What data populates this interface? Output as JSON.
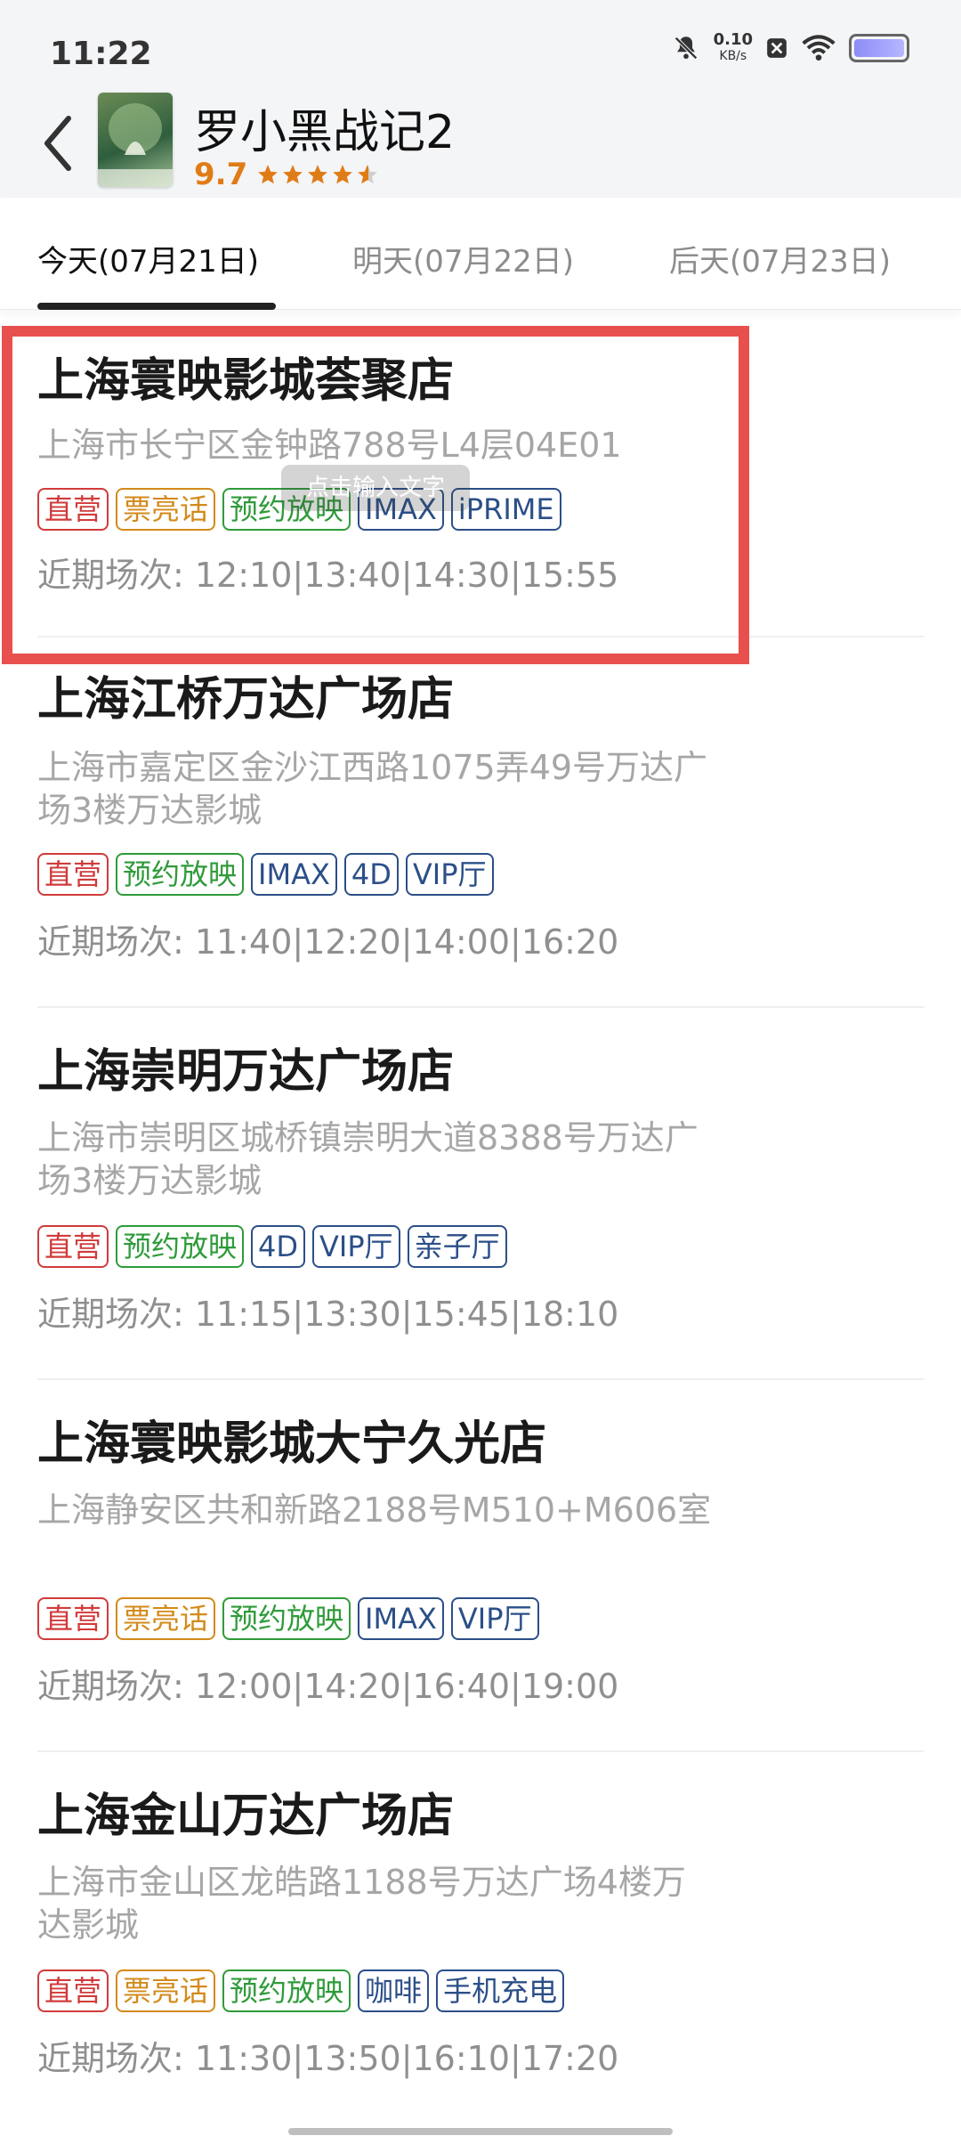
{
  "status": {
    "time": "11:22",
    "net_speed_value": "0.10",
    "net_speed_unit": "KB/s"
  },
  "header": {
    "title": "罗小黑战记2",
    "rating": "9.7"
  },
  "tabs": [
    {
      "label": "今天(07月21日)",
      "active": true
    },
    {
      "label": "明天(07月22日)",
      "active": false
    },
    {
      "label": "后天(07月23日)",
      "active": false
    }
  ],
  "cinemas": [
    {
      "name": "上海寰映影城荟聚店",
      "address": "上海市长宁区金钟路788号L4层04E01",
      "tags": [
        {
          "label": "直营",
          "color": "red"
        },
        {
          "label": "票亮话",
          "color": "orange"
        },
        {
          "label": "预约放映",
          "color": "green"
        },
        {
          "label": "IMAX",
          "color": "blue"
        },
        {
          "label": "iPRIME",
          "color": "blue"
        }
      ],
      "showtimes": "近期场次: 12:10|13:40|14:30|15:55"
    },
    {
      "name": "上海江桥万达广场店",
      "address": "上海市嘉定区金沙江西路1075弄49号万达广场3楼万达影城",
      "tags": [
        {
          "label": "直营",
          "color": "red"
        },
        {
          "label": "预约放映",
          "color": "green"
        },
        {
          "label": "IMAX",
          "color": "blue"
        },
        {
          "label": "4D",
          "color": "blue"
        },
        {
          "label": "VIP厅",
          "color": "blue"
        }
      ],
      "showtimes": "近期场次: 11:40|12:20|14:00|16:20"
    },
    {
      "name": "上海崇明万达广场店",
      "address": "上海市崇明区城桥镇崇明大道8388号万达广场3楼万达影城",
      "tags": [
        {
          "label": "直营",
          "color": "red"
        },
        {
          "label": "预约放映",
          "color": "green"
        },
        {
          "label": "4D",
          "color": "blue"
        },
        {
          "label": "VIP厅",
          "color": "blue"
        },
        {
          "label": "亲子厅",
          "color": "blue"
        }
      ],
      "showtimes": "近期场次: 11:15|13:30|15:45|18:10"
    },
    {
      "name": "上海寰映影城大宁久光店",
      "address": "上海静安区共和新路2188号M510+M606室",
      "tags": [
        {
          "label": "直营",
          "color": "red"
        },
        {
          "label": "票亮话",
          "color": "orange"
        },
        {
          "label": "预约放映",
          "color": "green"
        },
        {
          "label": "IMAX",
          "color": "blue"
        },
        {
          "label": "VIP厅",
          "color": "blue"
        }
      ],
      "showtimes": "近期场次: 12:00|14:20|16:40|19:00"
    },
    {
      "name": "上海金山万达广场店",
      "address": "上海市金山区龙皓路1188号万达广场4楼万达影城",
      "tags": [
        {
          "label": "直营",
          "color": "red"
        },
        {
          "label": "票亮话",
          "color": "orange"
        },
        {
          "label": "预约放映",
          "color": "green"
        },
        {
          "label": "咖啡",
          "color": "blue"
        },
        {
          "label": "手机充电",
          "color": "blue"
        }
      ],
      "showtimes": "近期场次: 11:30|13:50|16:10|17:20"
    }
  ],
  "toast": {
    "text": "点击输入文字"
  },
  "colors": {
    "highlight": "#e8504e",
    "rating": "#e07c17"
  }
}
